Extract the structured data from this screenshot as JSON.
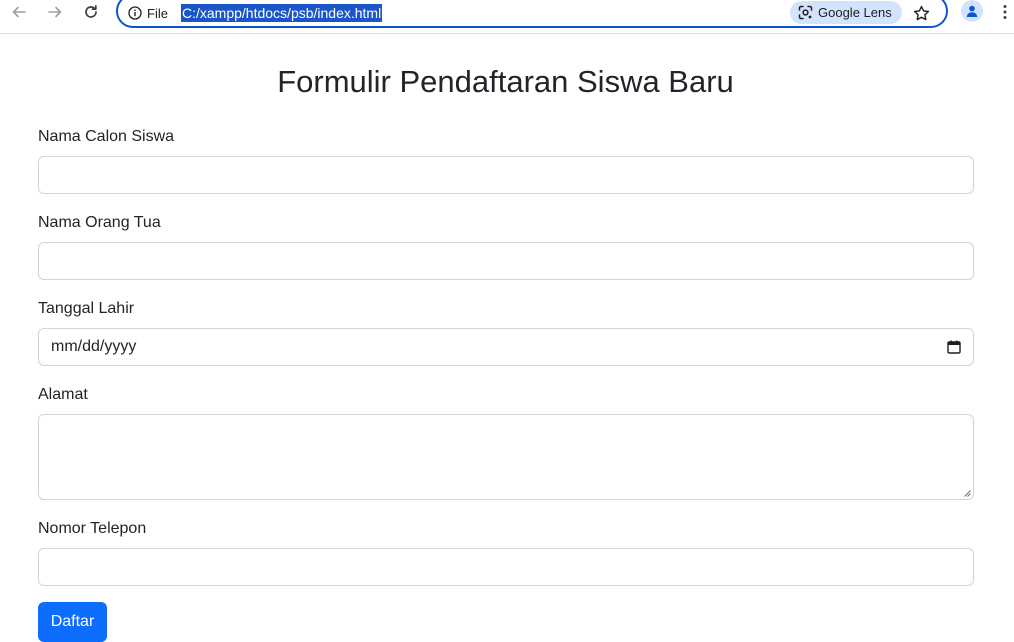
{
  "browser": {
    "site_info_label": "File",
    "url": "C:/xampp/htdocs/psb/index.html",
    "lens_label": "Google Lens",
    "icons": {
      "back": "arrow-left-icon",
      "forward": "arrow-right-icon",
      "reload": "reload-icon",
      "site_info": "info-icon",
      "lens": "google-lens-icon",
      "bookmark": "star-icon",
      "profile": "profile-icon",
      "menu": "more-vert-icon"
    }
  },
  "form": {
    "title": "Formulir Pendaftaran Siswa Baru",
    "fields": [
      {
        "label": "Nama Calon Siswa",
        "value": "",
        "type": "text"
      },
      {
        "label": "Nama Orang Tua",
        "value": "",
        "type": "text"
      },
      {
        "label": "Tanggal Lahir",
        "value": "",
        "placeholder": "mm/dd/yyyy",
        "type": "date"
      },
      {
        "label": "Alamat",
        "value": "",
        "type": "textarea"
      },
      {
        "label": "Nomor Telepon",
        "value": "",
        "type": "text"
      }
    ],
    "submit_label": "Daftar"
  },
  "colors": {
    "accent": "#0d6efd",
    "omnibox_focus": "#0b57d0",
    "url_selection": "#1a56c9",
    "lens_chip": "#d3e3fd",
    "input_border": "#ced4da",
    "text": "#212529"
  }
}
